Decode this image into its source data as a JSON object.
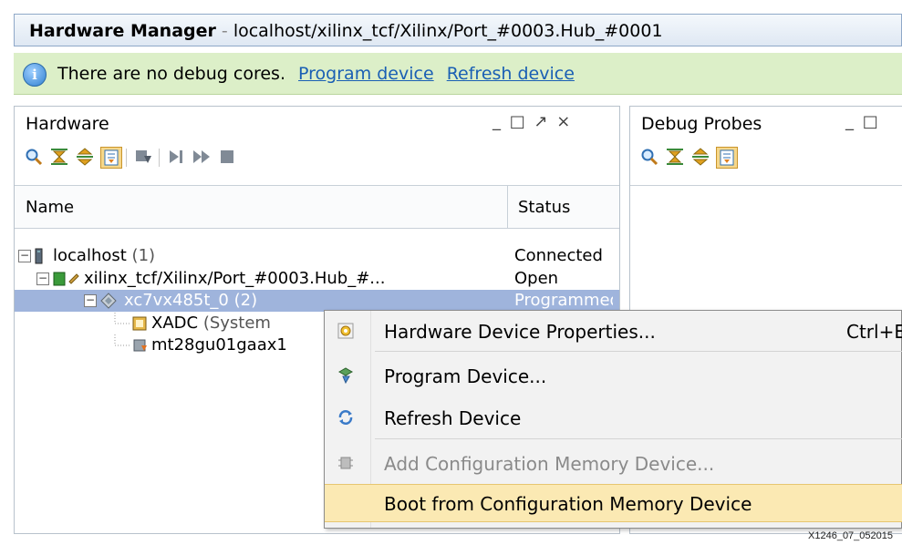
{
  "window": {
    "title": "Hardware Manager",
    "title_sep": " - ",
    "path": "localhost/xilinx_tcf/Xilinx/Port_#0003.Hub_#0001"
  },
  "banner": {
    "message": "There are no debug cores.",
    "link_program": "Program device",
    "link_refresh": "Refresh device"
  },
  "hardware_panel": {
    "title": "Hardware",
    "controls": "_ □ ↗ ×",
    "columns": {
      "name": "Name",
      "status": "Status"
    },
    "rows": [
      {
        "name": "localhost",
        "count": "(1)",
        "status": "Connected"
      },
      {
        "name": "xilinx_tcf/Xilinx/Port_#0003.Hub_#...",
        "status": "Open"
      },
      {
        "name": "xc7vx485t_0",
        "count": "(2)",
        "status": "Programmed"
      },
      {
        "name": "XADC",
        "detail": "(System",
        "status": ""
      },
      {
        "name": "mt28gu01gaax1",
        "status": ""
      }
    ]
  },
  "debug_panel": {
    "title": "Debug Probes",
    "controls": "_ □"
  },
  "context_menu": {
    "items": [
      {
        "label": "Hardware Device Properties...",
        "accelerator": "Ctrl+E",
        "enabled": true
      },
      {
        "label": "Program Device...",
        "enabled": true
      },
      {
        "label": "Refresh Device",
        "enabled": true
      },
      {
        "label": "Add Configuration Memory Device...",
        "enabled": false
      },
      {
        "label": "Boot from Configuration Memory Device",
        "enabled": true,
        "highlighted": true
      }
    ]
  },
  "caption": "X1246_07_052015",
  "colors": {
    "banner_bg": "#dcefc8",
    "selection": "#9fb4dc",
    "menu_highlight": "#fbe9b3",
    "link": "#1a5fb4"
  }
}
